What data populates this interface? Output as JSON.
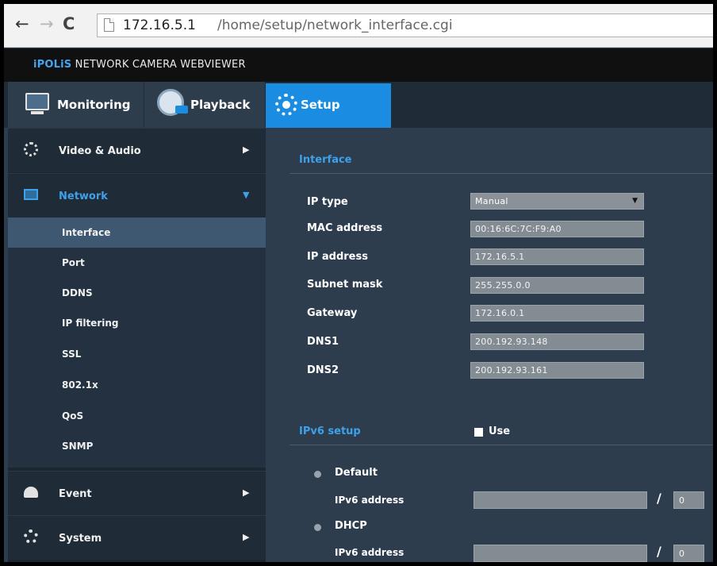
{
  "browser": {
    "back_glyph": "←",
    "forward_glyph": "→",
    "reload_glyph": "C",
    "url_host": "172.16.5.1",
    "url_path": "/home/setup/network_interface.cgi"
  },
  "app": {
    "brand": "iPOLiS",
    "title_rest": " NETWORK CAMERA WEBVIEWER",
    "accent_color": "#1a8de2"
  },
  "tabs": [
    {
      "label": "Monitoring",
      "icon": "monitor-icon"
    },
    {
      "label": "Playback",
      "icon": "film-reel-icon"
    },
    {
      "label": "Setup",
      "icon": "gear-icon",
      "active": true
    }
  ],
  "sidebar": {
    "main": [
      {
        "label": "Video & Audio",
        "icon": "film-reel-icon",
        "arrow": "▶"
      },
      {
        "label": "Network",
        "icon": "network-icon",
        "arrow": "▼",
        "expanded": true
      },
      {
        "label": "Event",
        "icon": "bell-icon",
        "arrow": "▶"
      },
      {
        "label": "System",
        "icon": "gear-icon",
        "arrow": "▶"
      }
    ],
    "sub": [
      "Interface",
      "Port",
      "DDNS",
      "IP filtering",
      "SSL",
      "802.1x",
      "QoS",
      "SNMP"
    ]
  },
  "interface": {
    "section_title": "Interface",
    "fields": [
      {
        "label": "IP type",
        "value": "Manual",
        "dropdown_glyph": "▼"
      },
      {
        "label": "MAC address",
        "value": "00:16:6C:7C:F9:A0"
      },
      {
        "label": "IP address",
        "value": "172.16.5.1"
      },
      {
        "label": "Subnet mask",
        "value": "255.255.0.0"
      },
      {
        "label": "Gateway",
        "value": "172.16.0.1"
      },
      {
        "label": "DNS1",
        "value": "200.192.93.148"
      },
      {
        "label": "DNS2",
        "value": "200.192.93.161"
      }
    ]
  },
  "ipv6": {
    "section_title": "IPv6 setup",
    "use_label": "Use",
    "use_checked": false,
    "options": [
      {
        "label": "Default",
        "address_label": "IPv6 address",
        "prefix": "0"
      },
      {
        "label": "DHCP",
        "address_label": "IPv6 address",
        "prefix": "0"
      }
    ],
    "slash": "/"
  }
}
